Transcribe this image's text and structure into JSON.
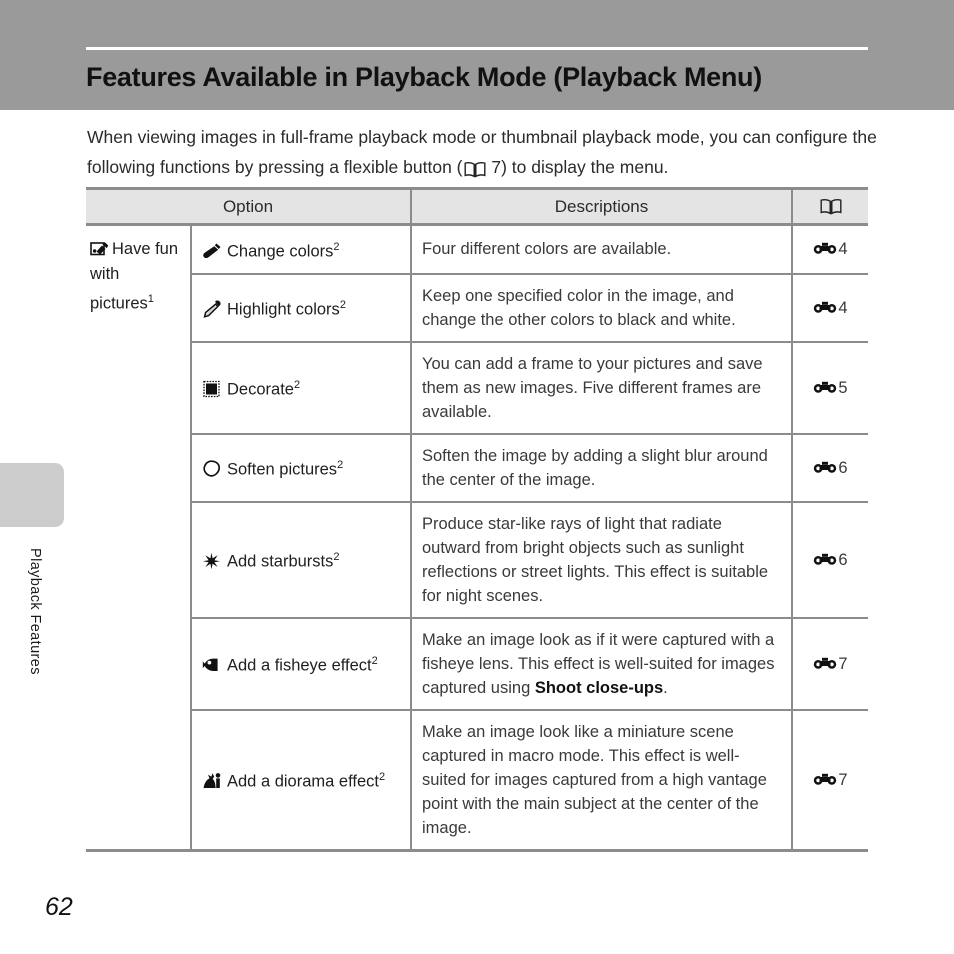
{
  "header": {
    "title": "Features Available in Playback Mode (Playback Menu)"
  },
  "intro": {
    "part1": "When viewing images in full-frame playback mode or thumbnail playback mode, you can configure the following functions by pressing a flexible button (",
    "book_ref_page": "7",
    "part2": ") to display the menu."
  },
  "sidebar": {
    "label": "Playback Features"
  },
  "page_number": "62",
  "table": {
    "columns": {
      "option": "Option",
      "descriptions": "Descriptions",
      "reference_icon": "open-book-icon"
    },
    "group": {
      "icon": "have-fun-with-pictures-icon",
      "label": "Have fun with pictures",
      "footnote": "1"
    },
    "rows": [
      {
        "icon": "paintbrush-icon",
        "option": "Change colors",
        "footnote": "2",
        "description": "Four different colors are available.",
        "ref": "4"
      },
      {
        "icon": "eyedropper-icon",
        "option": "Highlight colors",
        "footnote": "2",
        "description": "Keep one specified color in the image, and change the other colors to black and white.",
        "ref": "4"
      },
      {
        "icon": "frame-icon",
        "option": "Decorate",
        "footnote": "2",
        "description": "You can add a frame to your pictures and save them as new images. Five different frames are available.",
        "ref": "5"
      },
      {
        "icon": "soften-blob-icon",
        "option": "Soften pictures",
        "footnote": "2",
        "description": "Soften the image by adding a slight blur around the center of the image.",
        "ref": "6"
      },
      {
        "icon": "starburst-icon",
        "option": "Add starbursts",
        "footnote": "2",
        "description": "Produce star-like rays of light that radiate outward from bright objects such as sunlight reflections or street lights. This effect is suitable for night scenes.",
        "ref": "6"
      },
      {
        "icon": "fisheye-icon",
        "option": "Add a fisheye effect",
        "footnote": "2",
        "description_before": "Make an image look as if it were captured with a fisheye lens. This effect is well-suited for images captured using ",
        "description_bold": "Shoot close-ups",
        "description_after": ".",
        "ref": "7"
      },
      {
        "icon": "diorama-icon",
        "option": "Add a diorama effect",
        "footnote": "2",
        "description": "Make an image look like a miniature scene captured in macro mode. This effect is well-suited for images captured from a high vantage point with the main subject at the center of the image.",
        "ref": "7"
      }
    ]
  },
  "colors": {
    "header_band": "#9a9a9a",
    "table_header_bg": "#e4e4e4",
    "border": "#8c8c8c",
    "sidebar_tab": "#cccccc"
  }
}
